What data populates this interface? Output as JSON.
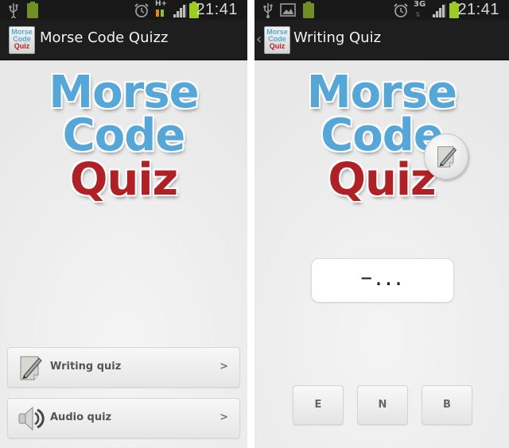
{
  "screens": [
    {
      "status_bar": {
        "icons": [
          "usb-icon",
          "battery-full-icon",
          "alarm-icon",
          "hspa-data-icon",
          "signal-icon",
          "battery-charging-icon"
        ],
        "network_label": "H+",
        "time": "21:41"
      },
      "action_bar": {
        "app_icon_lines": [
          "Morse",
          "Code",
          "Quiz"
        ],
        "title": "Morse Code Quizz"
      },
      "logo": {
        "line1": "Morse",
        "line2": "Code",
        "line3": "Quiz"
      },
      "menu": [
        {
          "label": "Writing quiz",
          "icon": "pencil-paper-icon",
          "arrow": ">"
        },
        {
          "label": "Audio quiz",
          "icon": "speaker-icon",
          "arrow": ">"
        }
      ]
    },
    {
      "status_bar": {
        "icons": [
          "usb-icon",
          "image-icon",
          "battery-full-icon",
          "alarm-icon",
          "3g-data-icon",
          "signal-icon",
          "battery-charging-icon"
        ],
        "network_label": "3G",
        "time": "21:41"
      },
      "action_bar": {
        "back_glyph": "‹",
        "app_icon_lines": [
          "Morse",
          "Code",
          "Quiz"
        ],
        "title": "Writing Quiz"
      },
      "logo": {
        "line1": "Morse",
        "line2": "Code",
        "line3": "Quiz",
        "badge_icon": "pencil-paper-icon"
      },
      "morse_code": "–...",
      "answers": [
        "E",
        "N",
        "B"
      ]
    }
  ],
  "colors": {
    "status_bar_bg": "#181818",
    "action_bar_bg": "#1e1e1e",
    "logo_blue": "#55a7da",
    "logo_red": "#b02024",
    "battery_green": "#9ccc1c"
  }
}
